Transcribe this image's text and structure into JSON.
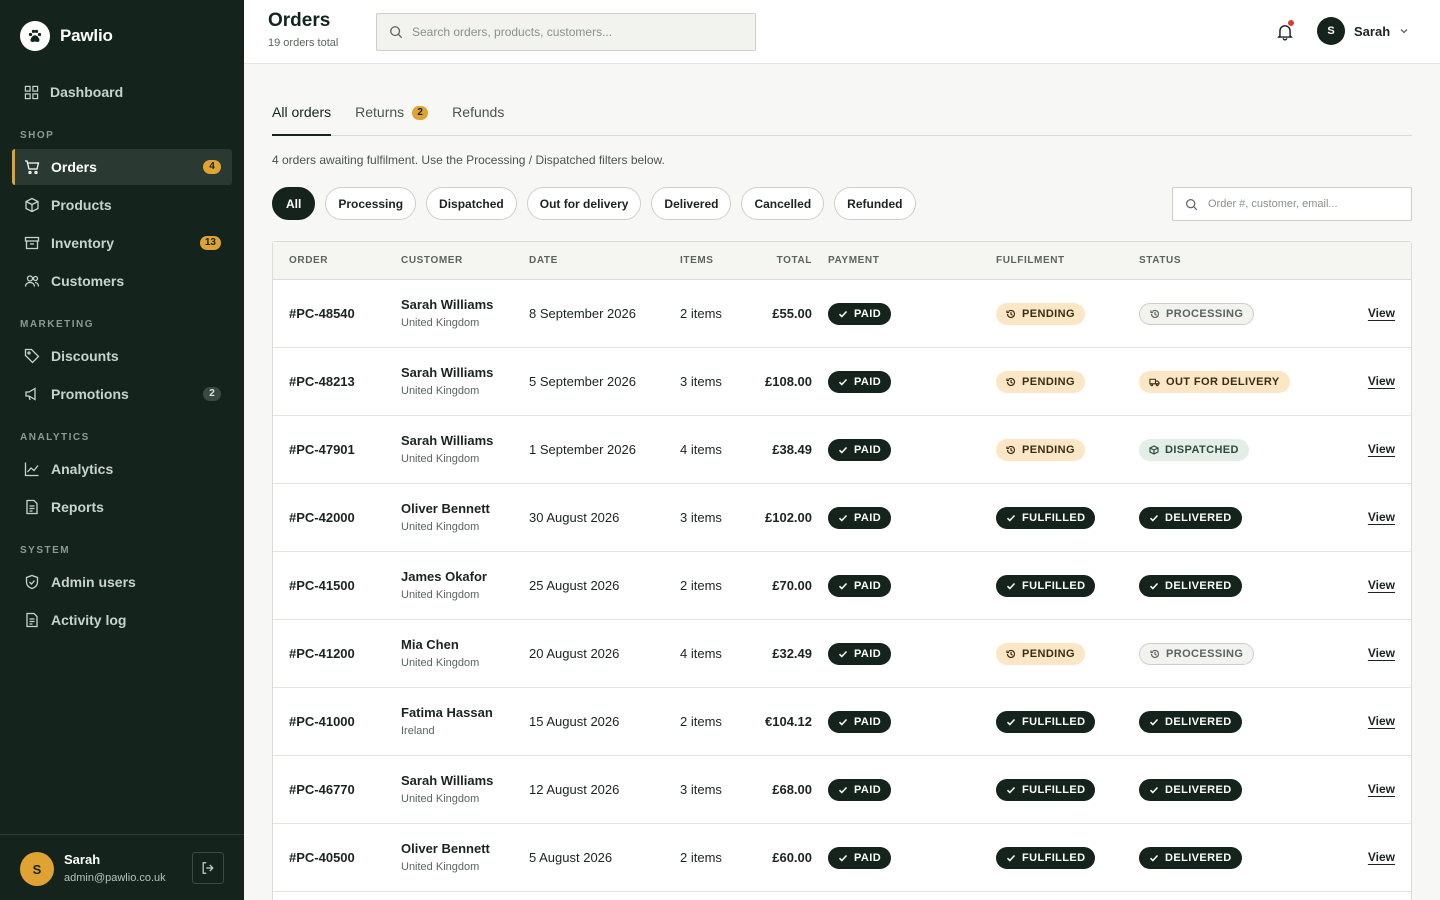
{
  "brand": {
    "name": "Pawlio"
  },
  "sidebar": {
    "dashboard": "Dashboard",
    "sections": {
      "shop": "SHOP",
      "marketing": "MARKETING",
      "analytics": "ANALYTICS",
      "system": "SYSTEM"
    },
    "items": {
      "orders": {
        "label": "Orders",
        "badge": "4"
      },
      "products": {
        "label": "Products"
      },
      "inventory": {
        "label": "Inventory",
        "badge": "13"
      },
      "customers": {
        "label": "Customers"
      },
      "discounts": {
        "label": "Discounts"
      },
      "promotions": {
        "label": "Promotions",
        "badge": "2"
      },
      "analytics": {
        "label": "Analytics"
      },
      "reports": {
        "label": "Reports"
      },
      "admin_users": {
        "label": "Admin users"
      },
      "activity_log": {
        "label": "Activity log"
      }
    },
    "user": {
      "initial": "S",
      "name": "Sarah",
      "email": "admin@pawlio.co.uk"
    }
  },
  "header": {
    "title": "Orders",
    "subtitle": "19 orders total",
    "search_placeholder": "Search orders, products, customers...",
    "user_initial": "S",
    "user_name": "Sarah"
  },
  "tabs": [
    {
      "label": "All orders"
    },
    {
      "label": "Returns",
      "badge": "2"
    },
    {
      "label": "Refunds"
    }
  ],
  "notice": "4 orders awaiting fulfilment. Use the Processing / Dispatched filters below.",
  "filters": [
    "All",
    "Processing",
    "Dispatched",
    "Out for delivery",
    "Delivered",
    "Cancelled",
    "Refunded"
  ],
  "filter_search_placeholder": "Order #, customer, email...",
  "table": {
    "headers": {
      "order": "ORDER",
      "customer": "CUSTOMER",
      "date": "DATE",
      "items": "ITEMS",
      "total": "TOTAL",
      "payment": "PAYMENT",
      "fulfilment": "FULFILMENT",
      "status": "STATUS"
    },
    "view_label": "View",
    "rows": [
      {
        "order": "#PC-48540",
        "name": "Sarah Williams",
        "country": "United Kingdom",
        "date": "8 September 2026",
        "items": "2 items",
        "total": "£55.00",
        "payment": "PAID",
        "fulfilment": "PENDING",
        "status": "PROCESSING"
      },
      {
        "order": "#PC-48213",
        "name": "Sarah Williams",
        "country": "United Kingdom",
        "date": "5 September 2026",
        "items": "3 items",
        "total": "£108.00",
        "payment": "PAID",
        "fulfilment": "PENDING",
        "status": "OUT FOR DELIVERY"
      },
      {
        "order": "#PC-47901",
        "name": "Sarah Williams",
        "country": "United Kingdom",
        "date": "1 September 2026",
        "items": "4 items",
        "total": "£38.49",
        "payment": "PAID",
        "fulfilment": "PENDING",
        "status": "DISPATCHED"
      },
      {
        "order": "#PC-42000",
        "name": "Oliver Bennett",
        "country": "United Kingdom",
        "date": "30 August 2026",
        "items": "3 items",
        "total": "£102.00",
        "payment": "PAID",
        "fulfilment": "FULFILLED",
        "status": "DELIVERED"
      },
      {
        "order": "#PC-41500",
        "name": "James Okafor",
        "country": "United Kingdom",
        "date": "25 August 2026",
        "items": "2 items",
        "total": "£70.00",
        "payment": "PAID",
        "fulfilment": "FULFILLED",
        "status": "DELIVERED"
      },
      {
        "order": "#PC-41200",
        "name": "Mia Chen",
        "country": "United Kingdom",
        "date": "20 August 2026",
        "items": "4 items",
        "total": "£32.49",
        "payment": "PAID",
        "fulfilment": "PENDING",
        "status": "PROCESSING"
      },
      {
        "order": "#PC-41000",
        "name": "Fatima Hassan",
        "country": "Ireland",
        "date": "15 August 2026",
        "items": "2 items",
        "total": "€104.12",
        "payment": "PAID",
        "fulfilment": "FULFILLED",
        "status": "DELIVERED"
      },
      {
        "order": "#PC-46770",
        "name": "Sarah Williams",
        "country": "United Kingdom",
        "date": "12 August 2026",
        "items": "3 items",
        "total": "£68.00",
        "payment": "PAID",
        "fulfilment": "FULFILLED",
        "status": "DELIVERED"
      },
      {
        "order": "#PC-40500",
        "name": "Oliver Bennett",
        "country": "United Kingdom",
        "date": "5 August 2026",
        "items": "2 items",
        "total": "£60.00",
        "payment": "PAID",
        "fulfilment": "FULFILLED",
        "status": "DELIVERED"
      }
    ]
  },
  "colors": {
    "sidebar_bg": "#14241c",
    "accent": "#e0a233",
    "pill_dark": "#14241c",
    "pill_amber": "#fbe7c6"
  }
}
